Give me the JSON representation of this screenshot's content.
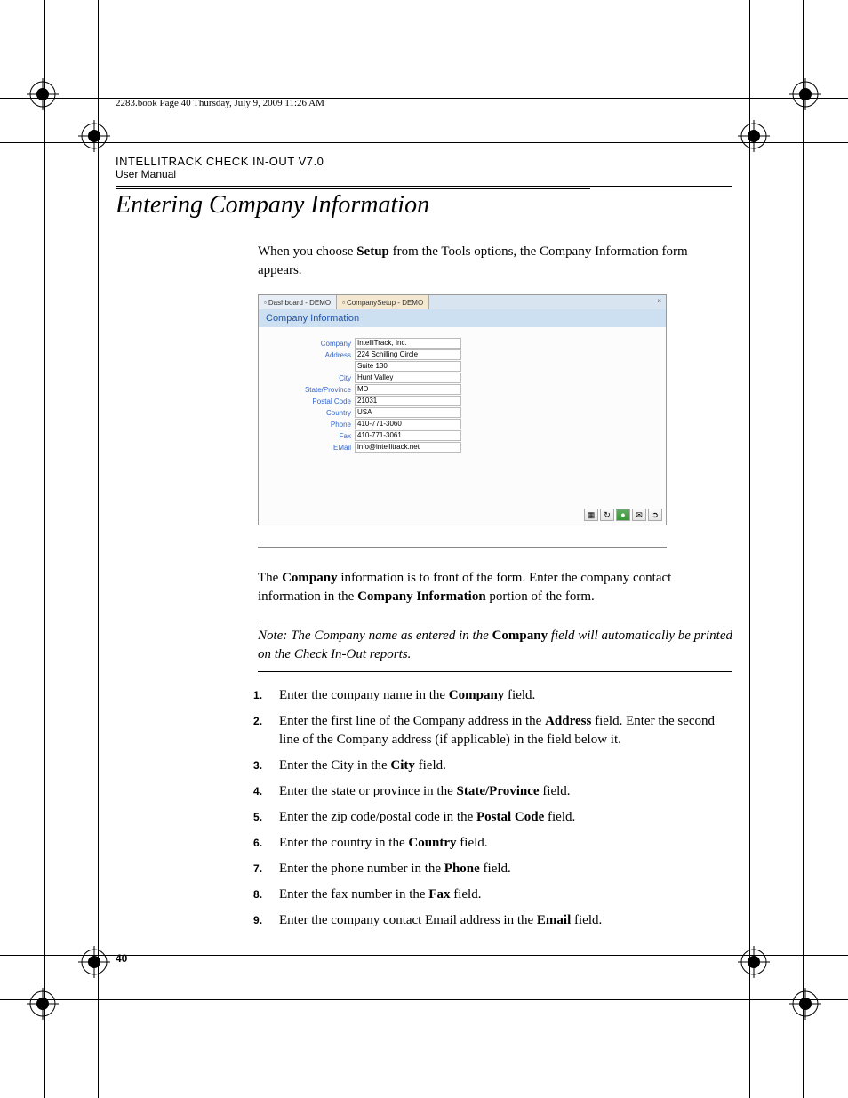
{
  "running_header": "2283.book  Page 40  Thursday, July 9, 2009  11:26 AM",
  "doc_header_line1": "INTELLITRACK CHECK IN-OUT V7.0",
  "doc_header_line2": "User Manual",
  "section_title": "Entering Company Information",
  "intro_para_pre": "When you choose ",
  "intro_para_bold": "Setup",
  "intro_para_post": " from the Tools options, the Company Information form appears.",
  "screenshot": {
    "tab1": "Dashboard - DEMO",
    "tab2": "CompanySetup - DEMO",
    "form_title": "Company Information",
    "fields": [
      {
        "label": "Company",
        "value": "IntelliTrack, Inc."
      },
      {
        "label": "Address",
        "value": "224 Schilling Circle"
      },
      {
        "label": "",
        "value": "Suite 130"
      },
      {
        "label": "City",
        "value": "Hunt Valley"
      },
      {
        "label": "State/Province",
        "value": "MD"
      },
      {
        "label": "Postal Code",
        "value": "21031"
      },
      {
        "label": "Country",
        "value": "USA"
      },
      {
        "label": "Phone",
        "value": "410-771-3060"
      },
      {
        "label": "Fax",
        "value": "410-771-3061"
      },
      {
        "label": "EMail",
        "value": "info@intellitrack.net"
      }
    ]
  },
  "para2_pre": "The ",
  "para2_b1": "Company",
  "para2_mid": " information is to front of the form. Enter the company contact information in the ",
  "para2_b2": "Company Information",
  "para2_post": " portion of the form.",
  "note_label": "Note:   ",
  "note_pre": "The Company name as entered in the ",
  "note_bold": "Company",
  "note_post": " field will automatically be printed on the Check In-Out reports.",
  "steps": [
    {
      "pre": "Enter the company name in the ",
      "b": "Company",
      "post": " field."
    },
    {
      "pre": "Enter the first line of the Company address in the ",
      "b": "Address",
      "post": " field. Enter the second line of the Company address (if applicable) in the field below it."
    },
    {
      "pre": "Enter the City in the ",
      "b": "City",
      "post": " field."
    },
    {
      "pre": "Enter the state or province in the ",
      "b": "State/Province",
      "post": " field."
    },
    {
      "pre": "Enter the zip code/postal code in the ",
      "b": "Postal Code",
      "post": " field."
    },
    {
      "pre": "Enter the country in the ",
      "b": "Country",
      "post": " field."
    },
    {
      "pre": "Enter the phone number in the ",
      "b": "Phone",
      "post": " field."
    },
    {
      "pre": "Enter the fax number in the ",
      "b": "Fax",
      "post": " field."
    },
    {
      "pre": "Enter the company contact Email address in the ",
      "b": "Email",
      "post": " field."
    }
  ],
  "page_number": "40"
}
